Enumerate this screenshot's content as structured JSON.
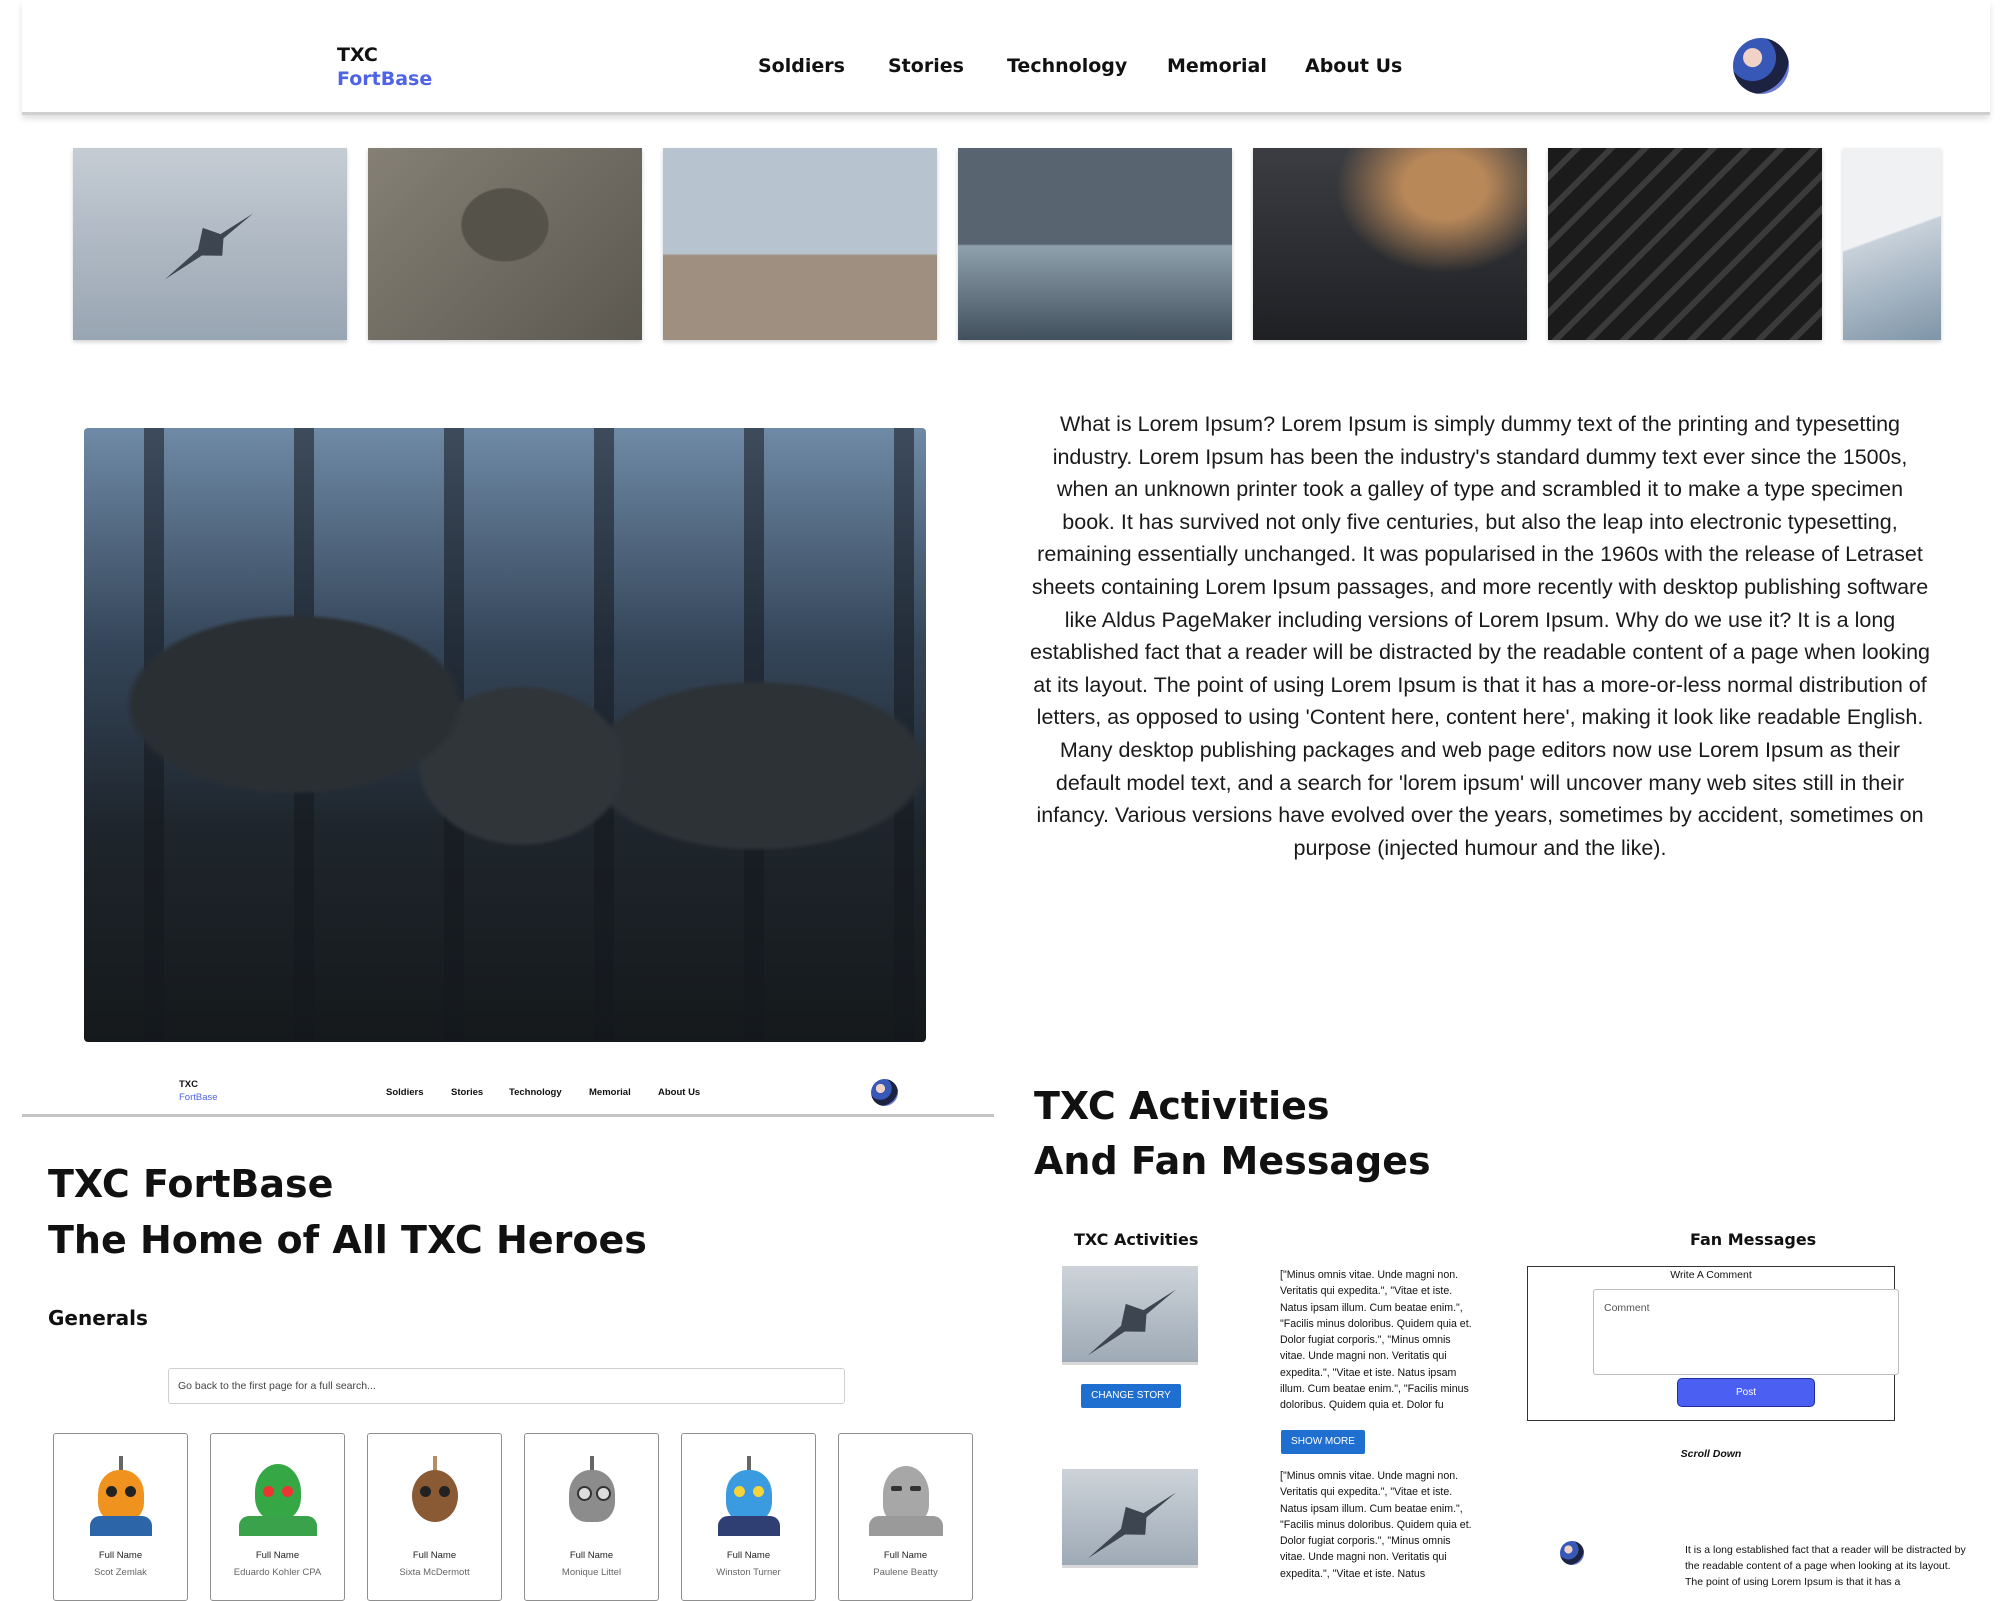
{
  "header": {
    "brand_top": "TXC",
    "brand_bottom": "FortBase",
    "nav": [
      "Soldiers",
      "Stories",
      "Technology",
      "Memorial",
      "About Us"
    ]
  },
  "intro_text": "What is Lorem Ipsum? Lorem Ipsum is simply dummy text of the printing and typesetting industry. Lorem Ipsum has been the industry's standard dummy text ever since the 1500s, when an unknown printer took a galley of type and scrambled it to make a type specimen book. It has survived not only five centuries, but also the leap into electronic typesetting, remaining essentially unchanged. It was popularised in the 1960s with the release of Letraset sheets containing Lorem Ipsum passages, and more recently with desktop publishing software like Aldus PageMaker including versions of Lorem Ipsum. Why do we use it? It is a long established fact that a reader will be distracted by the readable content of a page when looking at its layout. The point of using Lorem Ipsum is that it has a more-or-less normal distribution of letters, as opposed to using 'Content here, content here', making it look like readable English. Many desktop publishing packages and web page editors now use Lorem Ipsum as their default model text, and a search for 'lorem ipsum' will uncover many web sites still in their infancy. Various versions have evolved over the years, sometimes by accident, sometimes on purpose (injected humour and the like).",
  "mini_header": {
    "brand_top": "TXC",
    "brand_bottom": "FortBase",
    "nav": [
      "Soldiers",
      "Stories",
      "Technology",
      "Memorial",
      "About Us"
    ]
  },
  "home": {
    "title_line1": "TXC FortBase",
    "title_line2": "The Home of All TXC Heroes",
    "section": "Generals",
    "search_placeholder": "Go back to the first page for a full search...",
    "cards": [
      {
        "label": "Full Name",
        "name": "Scot Zemlak",
        "color": "#f0931e"
      },
      {
        "label": "Full Name",
        "name": "Eduardo Kohler CPA",
        "color": "#35a845"
      },
      {
        "label": "Full Name",
        "name": "Sixta McDermott",
        "color": "#8a5a35"
      },
      {
        "label": "Full Name",
        "name": "Monique Littel",
        "color": "#8c8c8c"
      },
      {
        "label": "Full Name",
        "name": "Winston Turner",
        "color": "#3a9be0"
      },
      {
        "label": "Full Name",
        "name": "Paulene Beatty",
        "color": "#a7a7a7"
      }
    ]
  },
  "activities": {
    "title_line1": "TXC Activities",
    "title_line2": "And Fan Messages",
    "col_title": "TXC Activities",
    "change_story": "CHANGE STORY",
    "story1": "[\"Minus omnis vitae. Unde magni non. Veritatis qui expedita.\", \"Vitae et iste. Natus ipsam illum. Cum beatae enim.\", \"Facilis minus doloribus. Quidem quia et. Dolor fugiat corporis.\", \"Minus omnis vitae. Unde magni non. Veritatis qui expedita.\", \"Vitae et iste. Natus ipsam illum. Cum beatae enim.\", \"Facilis minus doloribus. Quidem quia et. Dolor fu",
    "show_more": "SHOW MORE",
    "story2": "[\"Minus omnis vitae. Unde magni non. Veritatis qui expedita.\", \"Vitae et iste. Natus ipsam illum. Cum beatae enim.\", \"Facilis minus doloribus. Quidem quia et. Dolor fugiat corporis.\", \"Minus omnis vitae. Unde magni non. Veritatis qui expedita.\", \"Vitae et iste. Natus"
  },
  "fan": {
    "title": "Fan Messages",
    "write": "Write A Comment",
    "comment_placeholder": "Comment",
    "post": "Post",
    "scroll": "Scroll Down",
    "message": "It is a long established fact that a reader will be distracted by the readable content of a page when looking at its layout. The point of using Lorem Ipsum is that it has a"
  }
}
